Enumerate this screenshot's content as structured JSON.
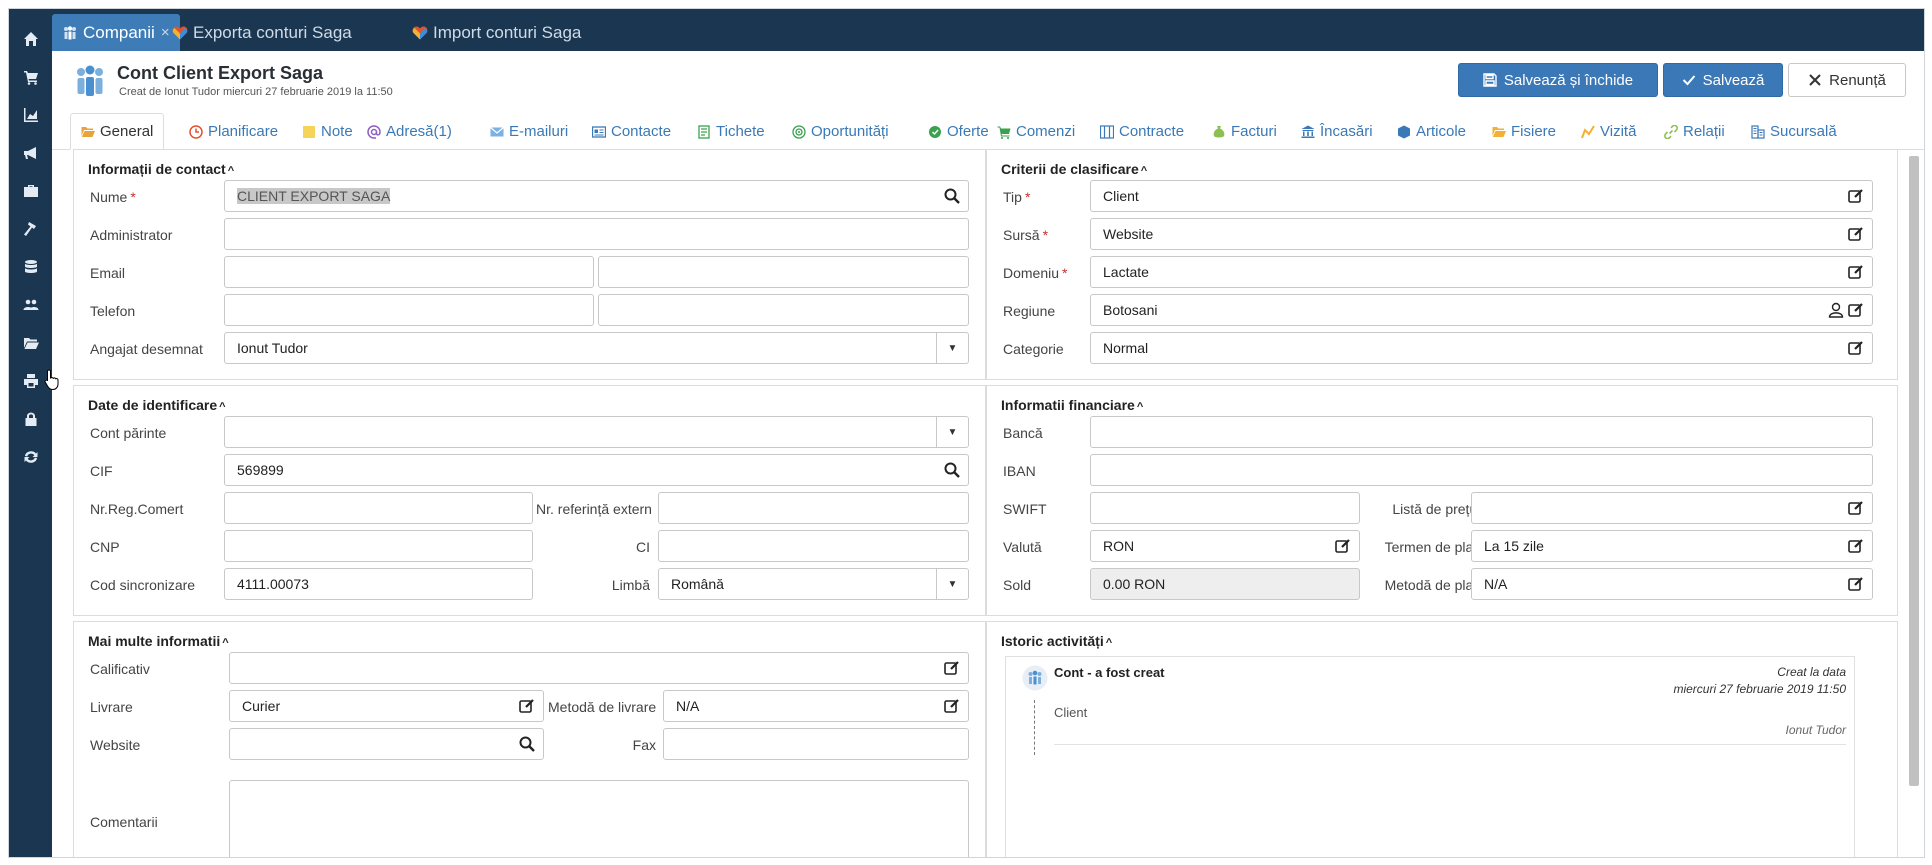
{
  "sidebar": {
    "items": [
      "home-icon",
      "cart-icon",
      "chart-icon",
      "megaphone-icon",
      "briefcase-icon",
      "hammer-icon",
      "database-icon",
      "users-icon",
      "folder-icon",
      "print-icon",
      "lock-icon",
      "refresh-icon"
    ]
  },
  "top_tabs": [
    {
      "label": "Companii",
      "active": true,
      "close": "×"
    },
    {
      "label": "Exporta conturi Saga",
      "active": false
    },
    {
      "label": "Import conturi Saga",
      "active": false
    }
  ],
  "header": {
    "title": "Cont Client Export Saga",
    "subtitle": "Creat de Ionut Tudor miercuri 27 februarie 2019 la 11:50",
    "btn_save_close": "Salvează și închide",
    "btn_save": "Salvează",
    "btn_cancel": "Renunță"
  },
  "sub_tabs": [
    "General",
    "Planificare",
    "Note",
    "Adresă(1)",
    "E-mailuri",
    "Contacte",
    "Tichete",
    "Oportunități",
    "Oferte",
    "Comenzi",
    "Contracte",
    "Facturi",
    "Încasări",
    "Articole",
    "Fisiere",
    "Vizită",
    "Relații",
    "Sucursală"
  ],
  "contact": {
    "title": "Informații de contact",
    "nume_label": "Nume",
    "nume_value": "CLIENT EXPORT SAGA",
    "admin_label": "Administrator",
    "email_label": "Email",
    "telefon_label": "Telefon",
    "angajat_label": "Angajat desemnat",
    "angajat_value": "Ionut Tudor"
  },
  "clasificare": {
    "title": "Criterii de clasificare",
    "tip_label": "Tip",
    "tip_value": "Client",
    "sursa_label": "Sursă",
    "sursa_value": "Website",
    "domeniu_label": "Domeniu",
    "domeniu_value": "Lactate",
    "regiune_label": "Regiune",
    "regiune_value": "Botosani",
    "categorie_label": "Categorie",
    "categorie_value": "Normal"
  },
  "identificare": {
    "title": "Date de identificare",
    "cont_parinte_label": "Cont părinte",
    "cif_label": "CIF",
    "cif_value": "569899",
    "nrreg_label": "Nr.Reg.Comert",
    "nrref_label": "Nr. referință extern",
    "cnp_label": "CNP",
    "ci_label": "CI",
    "cod_label": "Cod sincronizare",
    "cod_value": "4111.00073",
    "limba_label": "Limbă",
    "limba_value": "Română"
  },
  "financiare": {
    "title": "Informatii financiare",
    "banca_label": "Bancă",
    "iban_label": "IBAN",
    "swift_label": "SWIFT",
    "lista_label": "Listă de prețuri",
    "valuta_label": "Valută",
    "valuta_value": "RON",
    "termen_label": "Termen de plată",
    "termen_value": "La 15 zile",
    "sold_label": "Sold",
    "sold_value": "0.00 RON",
    "metoda_plata_label": "Metodă de plată",
    "metoda_plata_value": "N/A"
  },
  "mai_multe": {
    "title": "Mai multe informatii",
    "calificativ_label": "Calificativ",
    "livrare_label": "Livrare",
    "livrare_value": "Curier",
    "metoda_livrare_label": "Metodă de livrare",
    "metoda_livrare_value": "N/A",
    "website_label": "Website",
    "fax_label": "Fax",
    "comentarii_label": "Comentarii"
  },
  "istoric": {
    "title": "Istoric activități",
    "entry_title": "Cont - a fost creat",
    "entry_created": "Creat la data",
    "entry_date": "miercuri 27 februarie 2019 11:50",
    "entry_body": "Client",
    "entry_user": "Ionut Tudor"
  }
}
